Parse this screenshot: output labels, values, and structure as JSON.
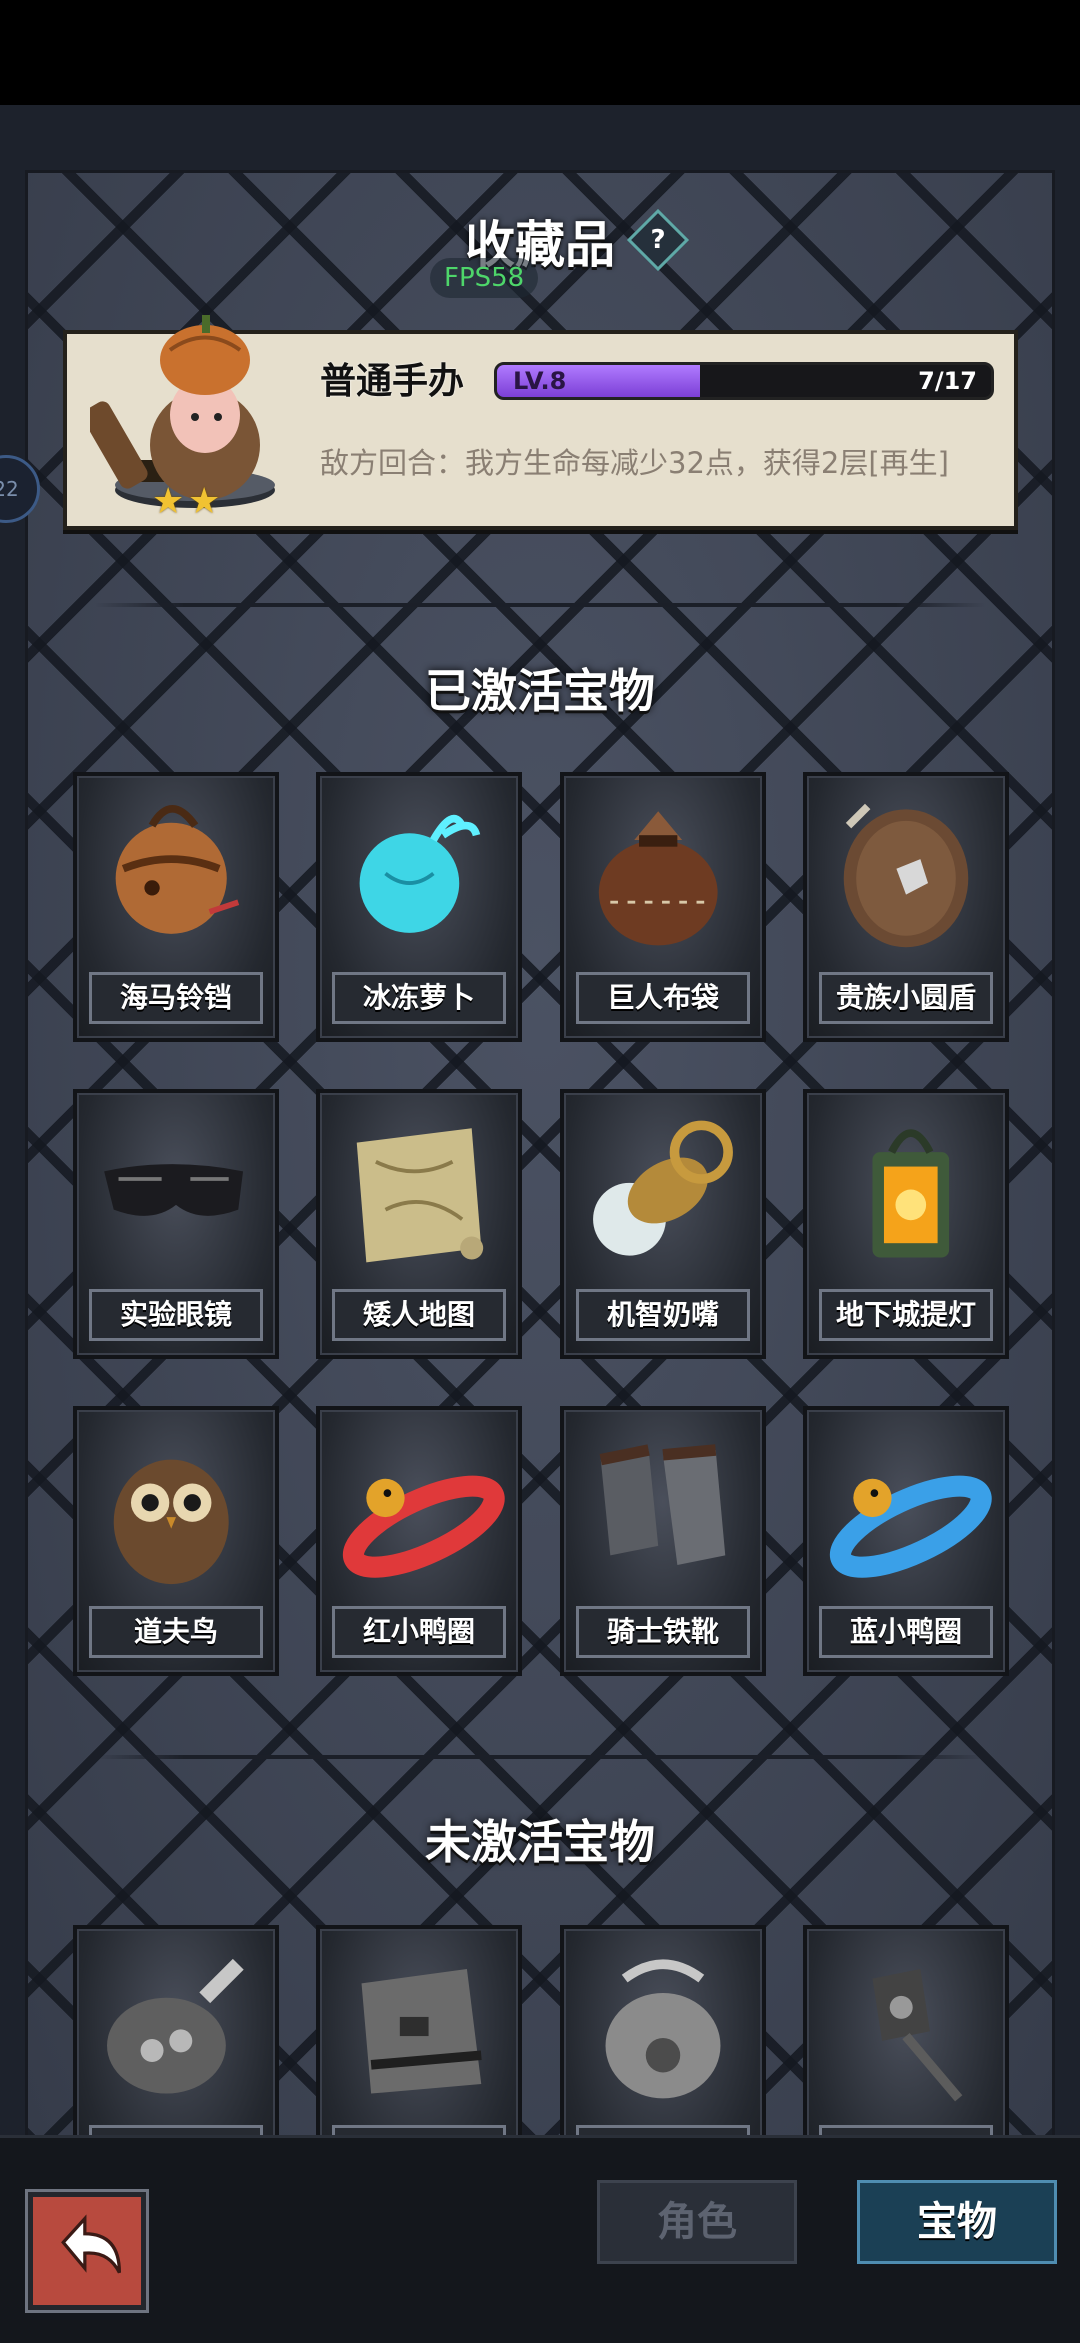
{
  "header": {
    "title": "收藏品",
    "help_icon": "?",
    "fps": "FPS58",
    "side_badge": "22"
  },
  "figure_card": {
    "name": "普通手办",
    "level_label": "LV.8",
    "progress_text": "7/17",
    "progress_current": 7,
    "progress_max": 17,
    "stars": 2,
    "description": "敌方回合：我方生命每减少32点，获得2层[再生]"
  },
  "active_section": {
    "title": "已激活宝物",
    "items": [
      {
        "label": "海马铃铛",
        "icon": "bell-icon"
      },
      {
        "label": "冰冻萝卜",
        "icon": "frozen-radish-icon"
      },
      {
        "label": "巨人布袋",
        "icon": "sack-icon"
      },
      {
        "label": "贵族小圆盾",
        "icon": "round-shield-icon"
      },
      {
        "label": "实验眼镜",
        "icon": "goggles-icon"
      },
      {
        "label": "矮人地图",
        "icon": "map-icon"
      },
      {
        "label": "机智奶嘴",
        "icon": "pacifier-icon"
      },
      {
        "label": "地下城提灯",
        "icon": "lantern-icon"
      },
      {
        "label": "道夫鸟",
        "icon": "owl-icon"
      },
      {
        "label": "红小鸭圈",
        "icon": "red-duck-ring-icon"
      },
      {
        "label": "骑士铁靴",
        "icon": "iron-boots-icon"
      },
      {
        "label": "蓝小鸭圈",
        "icon": "blue-duck-ring-icon"
      }
    ]
  },
  "inactive_section": {
    "title": "未激活宝物",
    "items": [
      {
        "label": "",
        "icon": "ham-icon"
      },
      {
        "label": "",
        "icon": "paper-box-icon"
      },
      {
        "label": "",
        "icon": "helmet-icon"
      },
      {
        "label": "",
        "icon": "torch-icon"
      }
    ]
  },
  "bottom_nav": {
    "back_icon": "back-arrow-icon",
    "tab_role": "角色",
    "tab_treasure": "宝物"
  },
  "colors": {
    "level_fill": "#9a5bf0",
    "active_tab": "#1b4055",
    "fps_text": "#4ed66a"
  }
}
